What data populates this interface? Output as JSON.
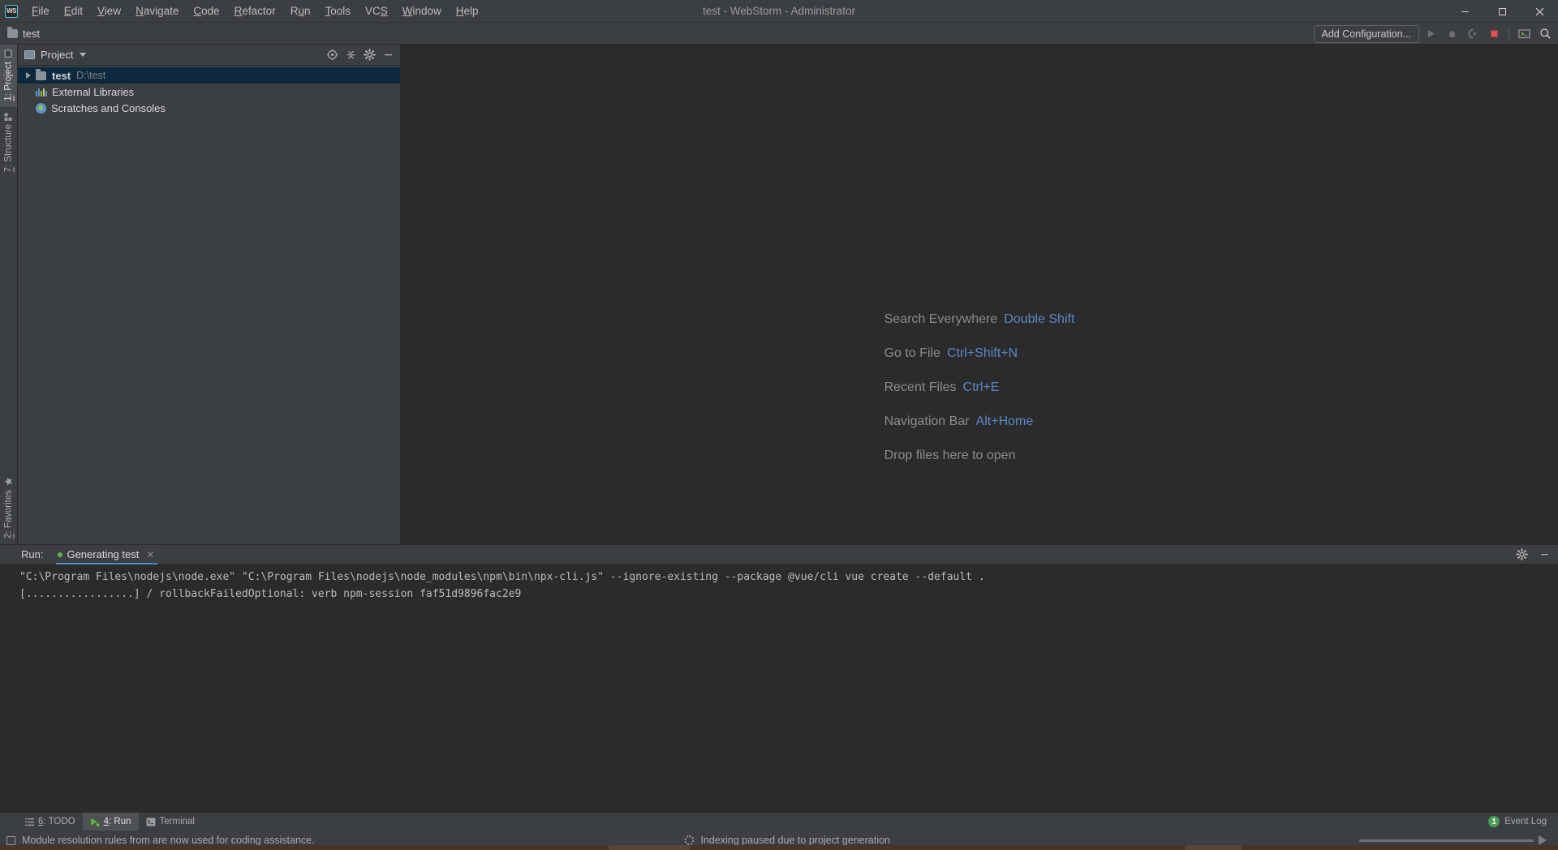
{
  "window": {
    "app_title": "test - WebStorm - Administrator",
    "logo_text": "WS",
    "minimize": "—",
    "maximize": "❐",
    "close": "✕"
  },
  "menu": {
    "items": [
      {
        "label": "File",
        "mnemonic": "F"
      },
      {
        "label": "Edit",
        "mnemonic": "E"
      },
      {
        "label": "View",
        "mnemonic": "V"
      },
      {
        "label": "Navigate",
        "mnemonic": "N"
      },
      {
        "label": "Code",
        "mnemonic": "C"
      },
      {
        "label": "Refactor",
        "mnemonic": "R"
      },
      {
        "label": "Run",
        "mnemonic": "u"
      },
      {
        "label": "Tools",
        "mnemonic": "T"
      },
      {
        "label": "VCS",
        "mnemonic": "S"
      },
      {
        "label": "Window",
        "mnemonic": "W"
      },
      {
        "label": "Help",
        "mnemonic": "H"
      }
    ]
  },
  "navbar": {
    "breadcrumb": "test",
    "add_configuration": "Add Configuration...",
    "icons": [
      "run-icon",
      "debug-icon",
      "coverage-icon",
      "stop-icon",
      "terminal-icon",
      "search-icon"
    ]
  },
  "left_stripe": {
    "top": [
      {
        "label": "1: Project",
        "mnemonic": "1",
        "icon": "project-icon",
        "active": true
      },
      {
        "label": "7: Structure",
        "mnemonic": "7",
        "icon": "structure-icon",
        "active": false
      }
    ],
    "bottom": [
      {
        "label": "2: Favorites",
        "mnemonic": "2",
        "icon": "star-icon",
        "active": false
      }
    ]
  },
  "project_panel": {
    "title": "Project",
    "toolbar_icons": [
      "locate-icon",
      "collapse-all-icon",
      "settings-icon",
      "hide-icon"
    ],
    "tree": [
      {
        "label": "test",
        "sub": "D:\\test",
        "icon": "folder-icon",
        "selected": true,
        "expandable": true,
        "bold": true,
        "indent": 0
      },
      {
        "label": "External Libraries",
        "sub": "",
        "icon": "libraries-icon",
        "selected": false,
        "expandable": false,
        "bold": false,
        "indent": 1
      },
      {
        "label": "Scratches and Consoles",
        "sub": "",
        "icon": "scratches-icon",
        "selected": false,
        "expandable": false,
        "bold": false,
        "indent": 1
      }
    ]
  },
  "editor": {
    "hints": [
      {
        "action": "Search Everywhere",
        "shortcut": "Double Shift"
      },
      {
        "action": "Go to File",
        "shortcut": "Ctrl+Shift+N"
      },
      {
        "action": "Recent Files",
        "shortcut": "Ctrl+E"
      },
      {
        "action": "Navigation Bar",
        "shortcut": "Alt+Home"
      },
      {
        "action": "Drop files here to open",
        "shortcut": ""
      }
    ]
  },
  "run_window": {
    "label": "Run:",
    "tab_title": "Generating test",
    "tab_close": "✕",
    "header_icons": [
      "settings-icon",
      "hide-icon"
    ],
    "console_lines": [
      "\"C:\\Program Files\\nodejs\\node.exe\" \"C:\\Program Files\\nodejs\\node_modules\\npm\\bin\\npx-cli.js\" --ignore-existing --package @vue/cli vue create --default .",
      "[.................] / rollbackFailedOptional: verb npm-session faf51d9896fac2e9"
    ]
  },
  "bottom_stripe": {
    "buttons": [
      {
        "label": "6: TODO",
        "mnemonic": "6",
        "icon": "todo-icon",
        "active": false
      },
      {
        "label": "4: Run",
        "mnemonic": "4",
        "icon": "run-icon",
        "active": true
      },
      {
        "label": "Terminal",
        "mnemonic": "",
        "icon": "terminal-icon",
        "active": false
      }
    ],
    "event_log": {
      "label": "Event Log",
      "count": "1"
    }
  },
  "statusbar": {
    "message": "Module resolution rules from  are now used for coding assistance.",
    "indexing": "Indexing paused due to project generation"
  },
  "colors": {
    "accent_blue": "#4a88c7",
    "link_blue": "#5b87c7",
    "selection": "#0d293e",
    "panel_bg": "#3c3f41",
    "editor_bg": "#2b2b2b",
    "green": "#62b543",
    "red_stop": "#e05252"
  }
}
